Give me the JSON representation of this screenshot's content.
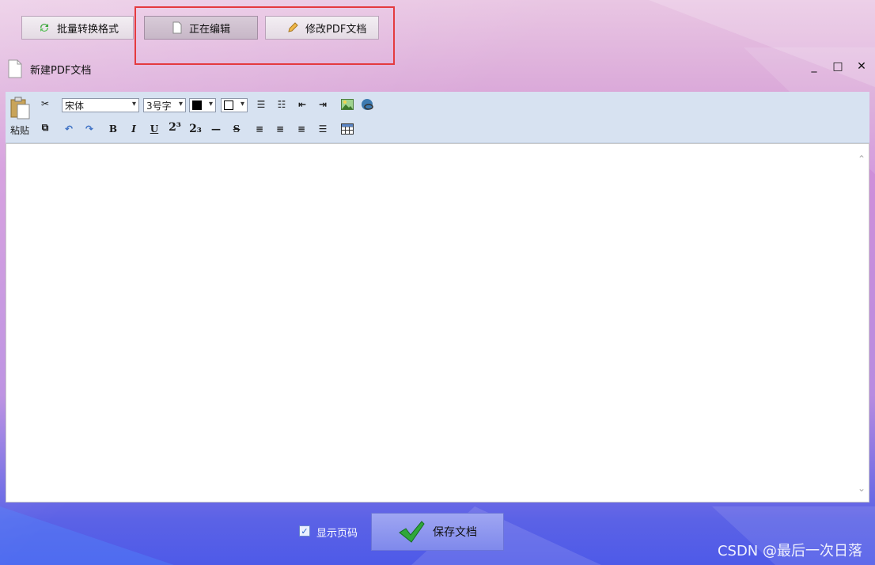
{
  "topbar": {
    "batch_convert": "批量转换格式",
    "editing": "正在编辑",
    "modify_pdf": "修改PDF文档"
  },
  "window": {
    "title": "新建PDF文档",
    "controls": {
      "minimize": "_",
      "maximize": "□",
      "close": "✕"
    }
  },
  "toolbar": {
    "paste": "粘贴",
    "font_name": "宋体",
    "font_size": "3号字",
    "bold": "B",
    "italic": "I",
    "underline": "U",
    "superscript": "2³",
    "subscript": "2₃",
    "hr": "—",
    "strike": "S"
  },
  "footer": {
    "show_page_numbers": "显示页码",
    "save_button": "保存文档"
  },
  "watermark": "CSDN @最后一次日落",
  "colors": {
    "accent_red": "#e43a3f",
    "toolbar_bg": "#d7e2f1"
  }
}
